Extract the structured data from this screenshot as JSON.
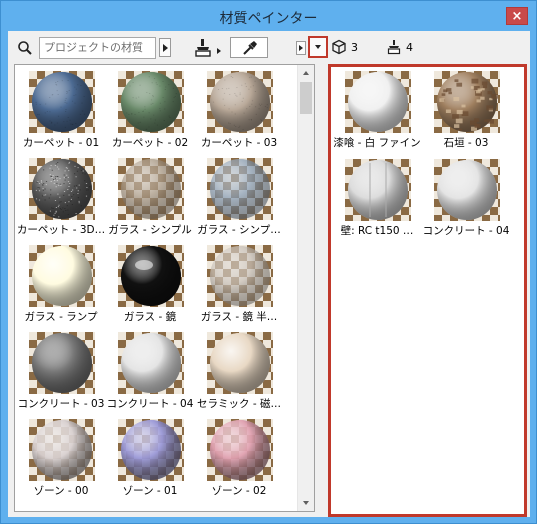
{
  "window": {
    "title": "材質ペインター",
    "close_label": "×"
  },
  "toolbar": {
    "search_placeholder": "プロジェクトの材質",
    "icons": [
      "search-icon",
      "pick-material-icon",
      "eyedropper-icon",
      "next-arrow-icon",
      "dropdown-arrow-icon"
    ]
  },
  "stats": {
    "object_count": "3",
    "pick_count": "4"
  },
  "library": {
    "items": [
      {
        "label": "カーペット - 01",
        "color": "#4c6a92",
        "style": "rough"
      },
      {
        "label": "カーペット - 02",
        "color": "#6a8a6a",
        "style": "rough"
      },
      {
        "label": "カーペット - 03",
        "color": "#b8a898",
        "style": "rough"
      },
      {
        "label": "カーペット - 3D…",
        "color": "#5a5a5a",
        "style": "speckle"
      },
      {
        "label": "ガラス - シンプル",
        "color": "#a89a88",
        "style": "glass"
      },
      {
        "label": "ガラス - シンプ…",
        "color": "#8aa0b8",
        "style": "glass"
      },
      {
        "label": "ガラス - ランプ",
        "color": "#fffbe0",
        "style": "lamp"
      },
      {
        "label": "ガラス - 鏡",
        "color": "#111111",
        "style": "mirror"
      },
      {
        "label": "ガラス - 鏡 半…",
        "color": "#c8c0b8",
        "style": "glass"
      },
      {
        "label": "コンクリート - 03",
        "color": "#7a7a7a",
        "style": "matte"
      },
      {
        "label": "コンクリート - 04",
        "color": "#e4e4e4",
        "style": "matte"
      },
      {
        "label": "セラミック - 磁…",
        "color": "#e8d8c4",
        "style": "gloss"
      },
      {
        "label": "ゾーン - 00",
        "color": "#d8d0d0",
        "style": "zone"
      },
      {
        "label": "ゾーン - 01",
        "color": "#9a98d8",
        "style": "zone"
      },
      {
        "label": "ゾーン - 02",
        "color": "#e0a0b0",
        "style": "zone"
      }
    ]
  },
  "favorites": {
    "items": [
      {
        "label": "漆喰 - 白 ファイン",
        "color": "#f0f0f0",
        "style": "matte"
      },
      {
        "label": "石垣 - 03",
        "color": "#a08060",
        "style": "stone"
      },
      {
        "label": "壁: RC t150 …",
        "color": "#dcdcdc",
        "style": "wall"
      },
      {
        "label": "コンクリート - 04",
        "color": "#e4e4e4",
        "style": "matte"
      }
    ]
  }
}
